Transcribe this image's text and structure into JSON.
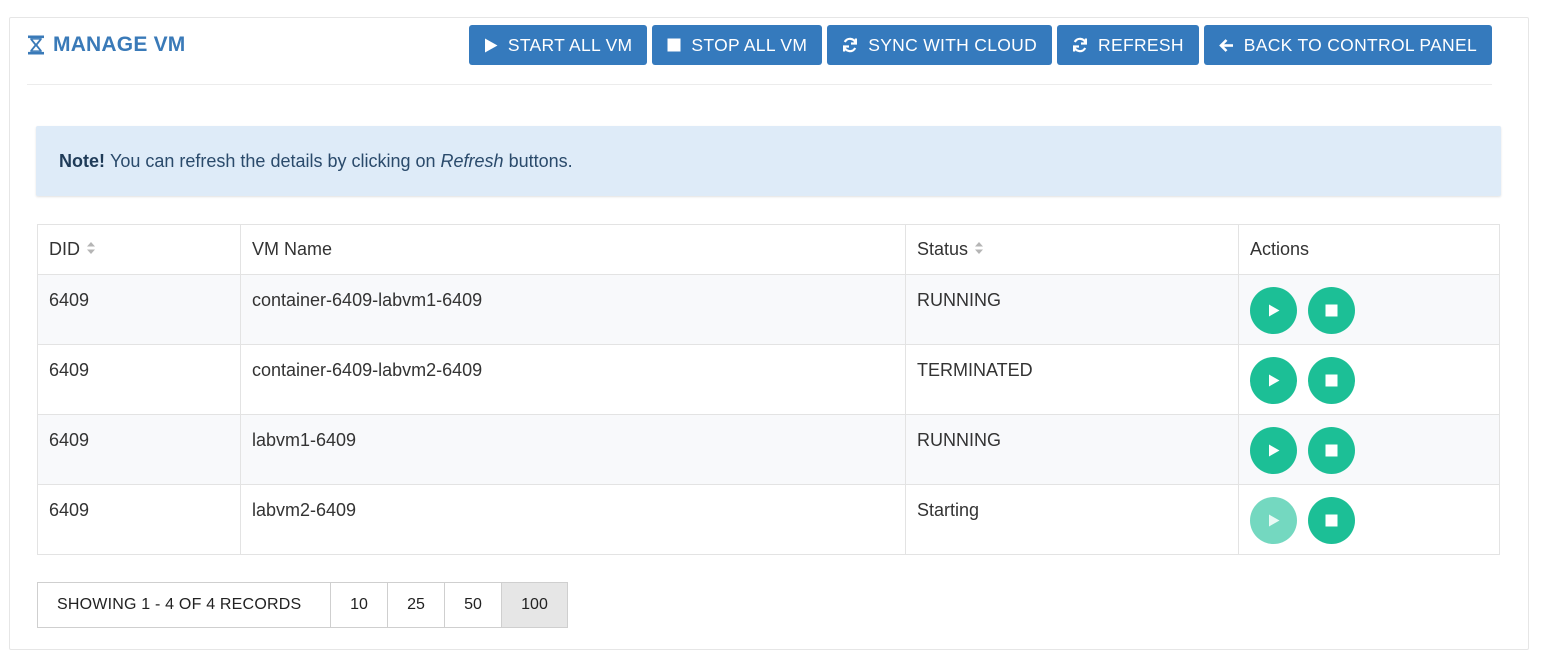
{
  "header": {
    "title": "MANAGE VM",
    "title_icon": "hourglass-icon"
  },
  "toolbar": {
    "start_all": "START ALL VM",
    "stop_all": "STOP ALL VM",
    "sync": "SYNC WITH CLOUD",
    "refresh": "REFRESH",
    "back": "BACK TO CONTROL PANEL"
  },
  "note": {
    "bold": "Note!",
    "before": "You can refresh the details by clicking on",
    "italic": "Refresh",
    "after": "buttons."
  },
  "table": {
    "columns": {
      "did": "DID",
      "vm_name": "VM Name",
      "status": "Status",
      "actions": "Actions"
    },
    "rows": [
      {
        "did": "6409",
        "vm_name": "container-6409-labvm1-6409",
        "status": "RUNNING",
        "start_enabled": true
      },
      {
        "did": "6409",
        "vm_name": "container-6409-labvm2-6409",
        "status": "TERMINATED",
        "start_enabled": true
      },
      {
        "did": "6409",
        "vm_name": "labvm1-6409",
        "status": "RUNNING",
        "start_enabled": true
      },
      {
        "did": "6409",
        "vm_name": "labvm2-6409",
        "status": "Starting",
        "start_enabled": false
      }
    ]
  },
  "pagination": {
    "info": "SHOWING 1 - 4 OF 4 RECORDS",
    "sizes": [
      "10",
      "25",
      "50",
      "100"
    ],
    "active": "100"
  },
  "colors": {
    "primary": "#357abd",
    "title": "#3a7ab8",
    "action_green": "#1cbf96",
    "action_green_disabled": "#74d8c0",
    "note_bg": "#deebf8"
  }
}
